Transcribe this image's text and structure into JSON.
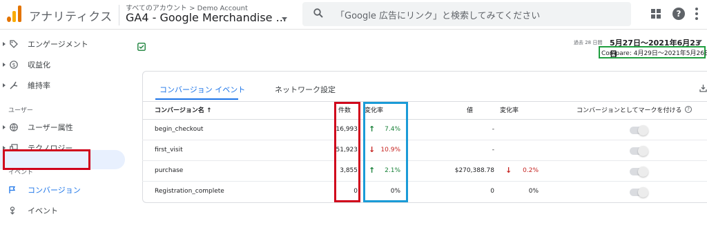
{
  "header": {
    "app_title": "アナリティクス",
    "breadcrumb": "すべてのアカウント > Demo Account",
    "property": "GA4 - Google Merchandise ...",
    "search_placeholder": "「Google 広告にリンク」と検索してみてください",
    "icons": [
      "analytics-logo",
      "search-icon",
      "apps-icon",
      "help-icon",
      "more-vert-icon"
    ]
  },
  "sidebar": {
    "items_top": [
      {
        "label": "エンゲージメント",
        "icon": "tag-icon"
      },
      {
        "label": "収益化",
        "icon": "dollar-icon"
      },
      {
        "label": "維持率",
        "icon": "retention-icon"
      }
    ],
    "section_user": "ユーザー",
    "items_user": [
      {
        "label": "ユーザー属性",
        "icon": "globe-icon"
      },
      {
        "label": "テクノロジー",
        "icon": "devices-icon"
      }
    ],
    "section_event": "イベント",
    "items_event": [
      {
        "label": "コンバージョン",
        "icon": "flag-icon",
        "active": true
      },
      {
        "label": "イベント",
        "icon": "touch-icon"
      }
    ]
  },
  "date": {
    "prefix": "過去 28 日間",
    "range": "5月27日～2021年6月23日",
    "compare": "Compare: 4月29日～2021年5月26日"
  },
  "tabs": [
    "コンバージョン イベント",
    "ネットワーク設定"
  ],
  "table": {
    "headers": {
      "name": "コンバージョン名 ↑",
      "count": "件数",
      "change": "変化率",
      "value": "値",
      "value_change": "変化率",
      "mark": "コンバージョンとしてマークを付ける"
    },
    "rows": [
      {
        "name": "begin_checkout",
        "count": "16,993",
        "arrow": "↑",
        "change": "7.4%",
        "dir": "up",
        "value": "-",
        "value_arrow": "",
        "value_change": ""
      },
      {
        "name": "first_visit",
        "count": "51,923",
        "arrow": "↓",
        "change": "10.9%",
        "dir": "down",
        "value": "-",
        "value_arrow": "",
        "value_change": ""
      },
      {
        "name": "purchase",
        "count": "3,855",
        "arrow": "↑",
        "change": "2.1%",
        "dir": "up",
        "value": "$270,388.78",
        "value_arrow": "↓",
        "value_change": "0.2%"
      },
      {
        "name": "Registration_complete",
        "count": "0",
        "arrow": "",
        "change": "0%",
        "dir": "none",
        "value": "0",
        "value_arrow": "",
        "value_change": "0%"
      }
    ]
  },
  "colors": {
    "accent": "#1a73e8",
    "highlight_red": "#d0021b",
    "highlight_blue": "#1a9bd7",
    "highlight_green": "#1e9e3e",
    "up": "#188038",
    "down": "#c5221f"
  }
}
